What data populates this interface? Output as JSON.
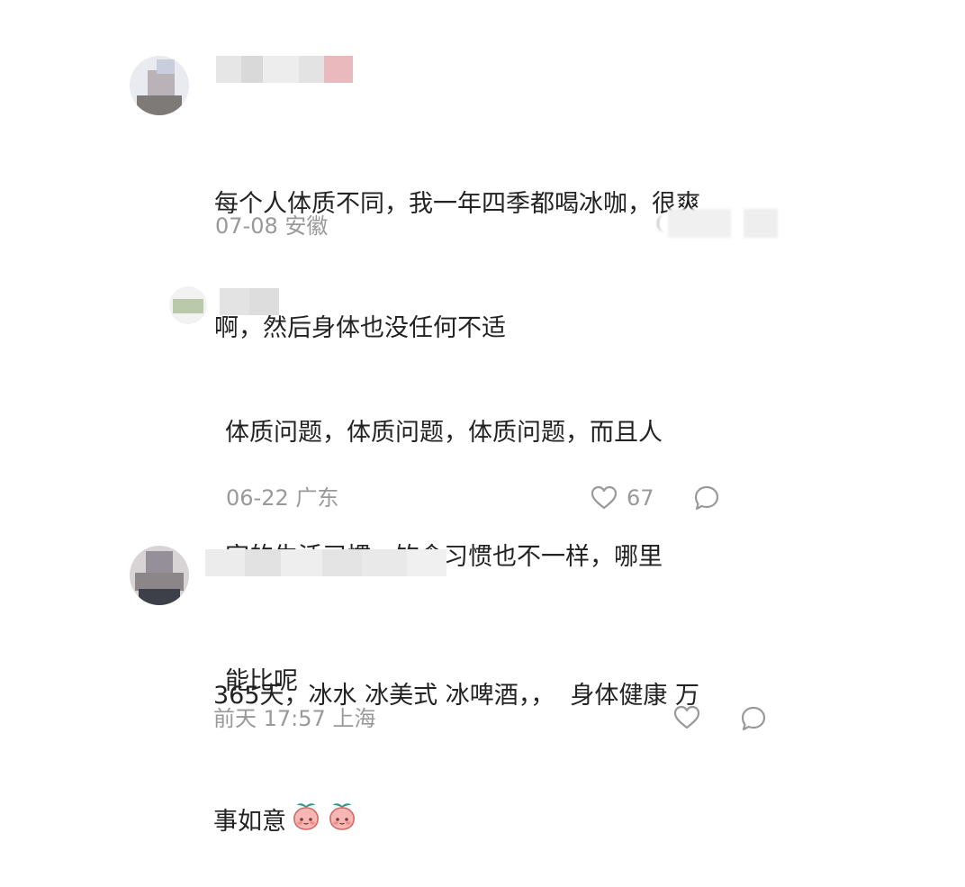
{
  "comments": [
    {
      "text": "每个人体质不同，我一年四季都喝冰咖，很爽啊，然后身体也没任何不适",
      "line1": "每个人体质不同，我一年四季都喝冰咖，很爽",
      "line2": "啊，然后身体也没任何不适",
      "date": "07-08",
      "location": "安徽"
    },
    {
      "line1": "体质问题，体质问题，体质问题，而且人",
      "line2": "家的生活习惯，饮食习惯也不一样，哪里",
      "line3": "能比呢",
      "date": "06-22",
      "location": "广东",
      "like_count": "67"
    },
    {
      "line1": "365天，冰水 冰美式 冰啤酒，，  身体健康 万",
      "line2": "事如意",
      "date": "前天 17:57",
      "location": "上海",
      "emoji": "peach-emoji"
    }
  ],
  "colors": {
    "meta": "#999999",
    "text": "#222222"
  }
}
